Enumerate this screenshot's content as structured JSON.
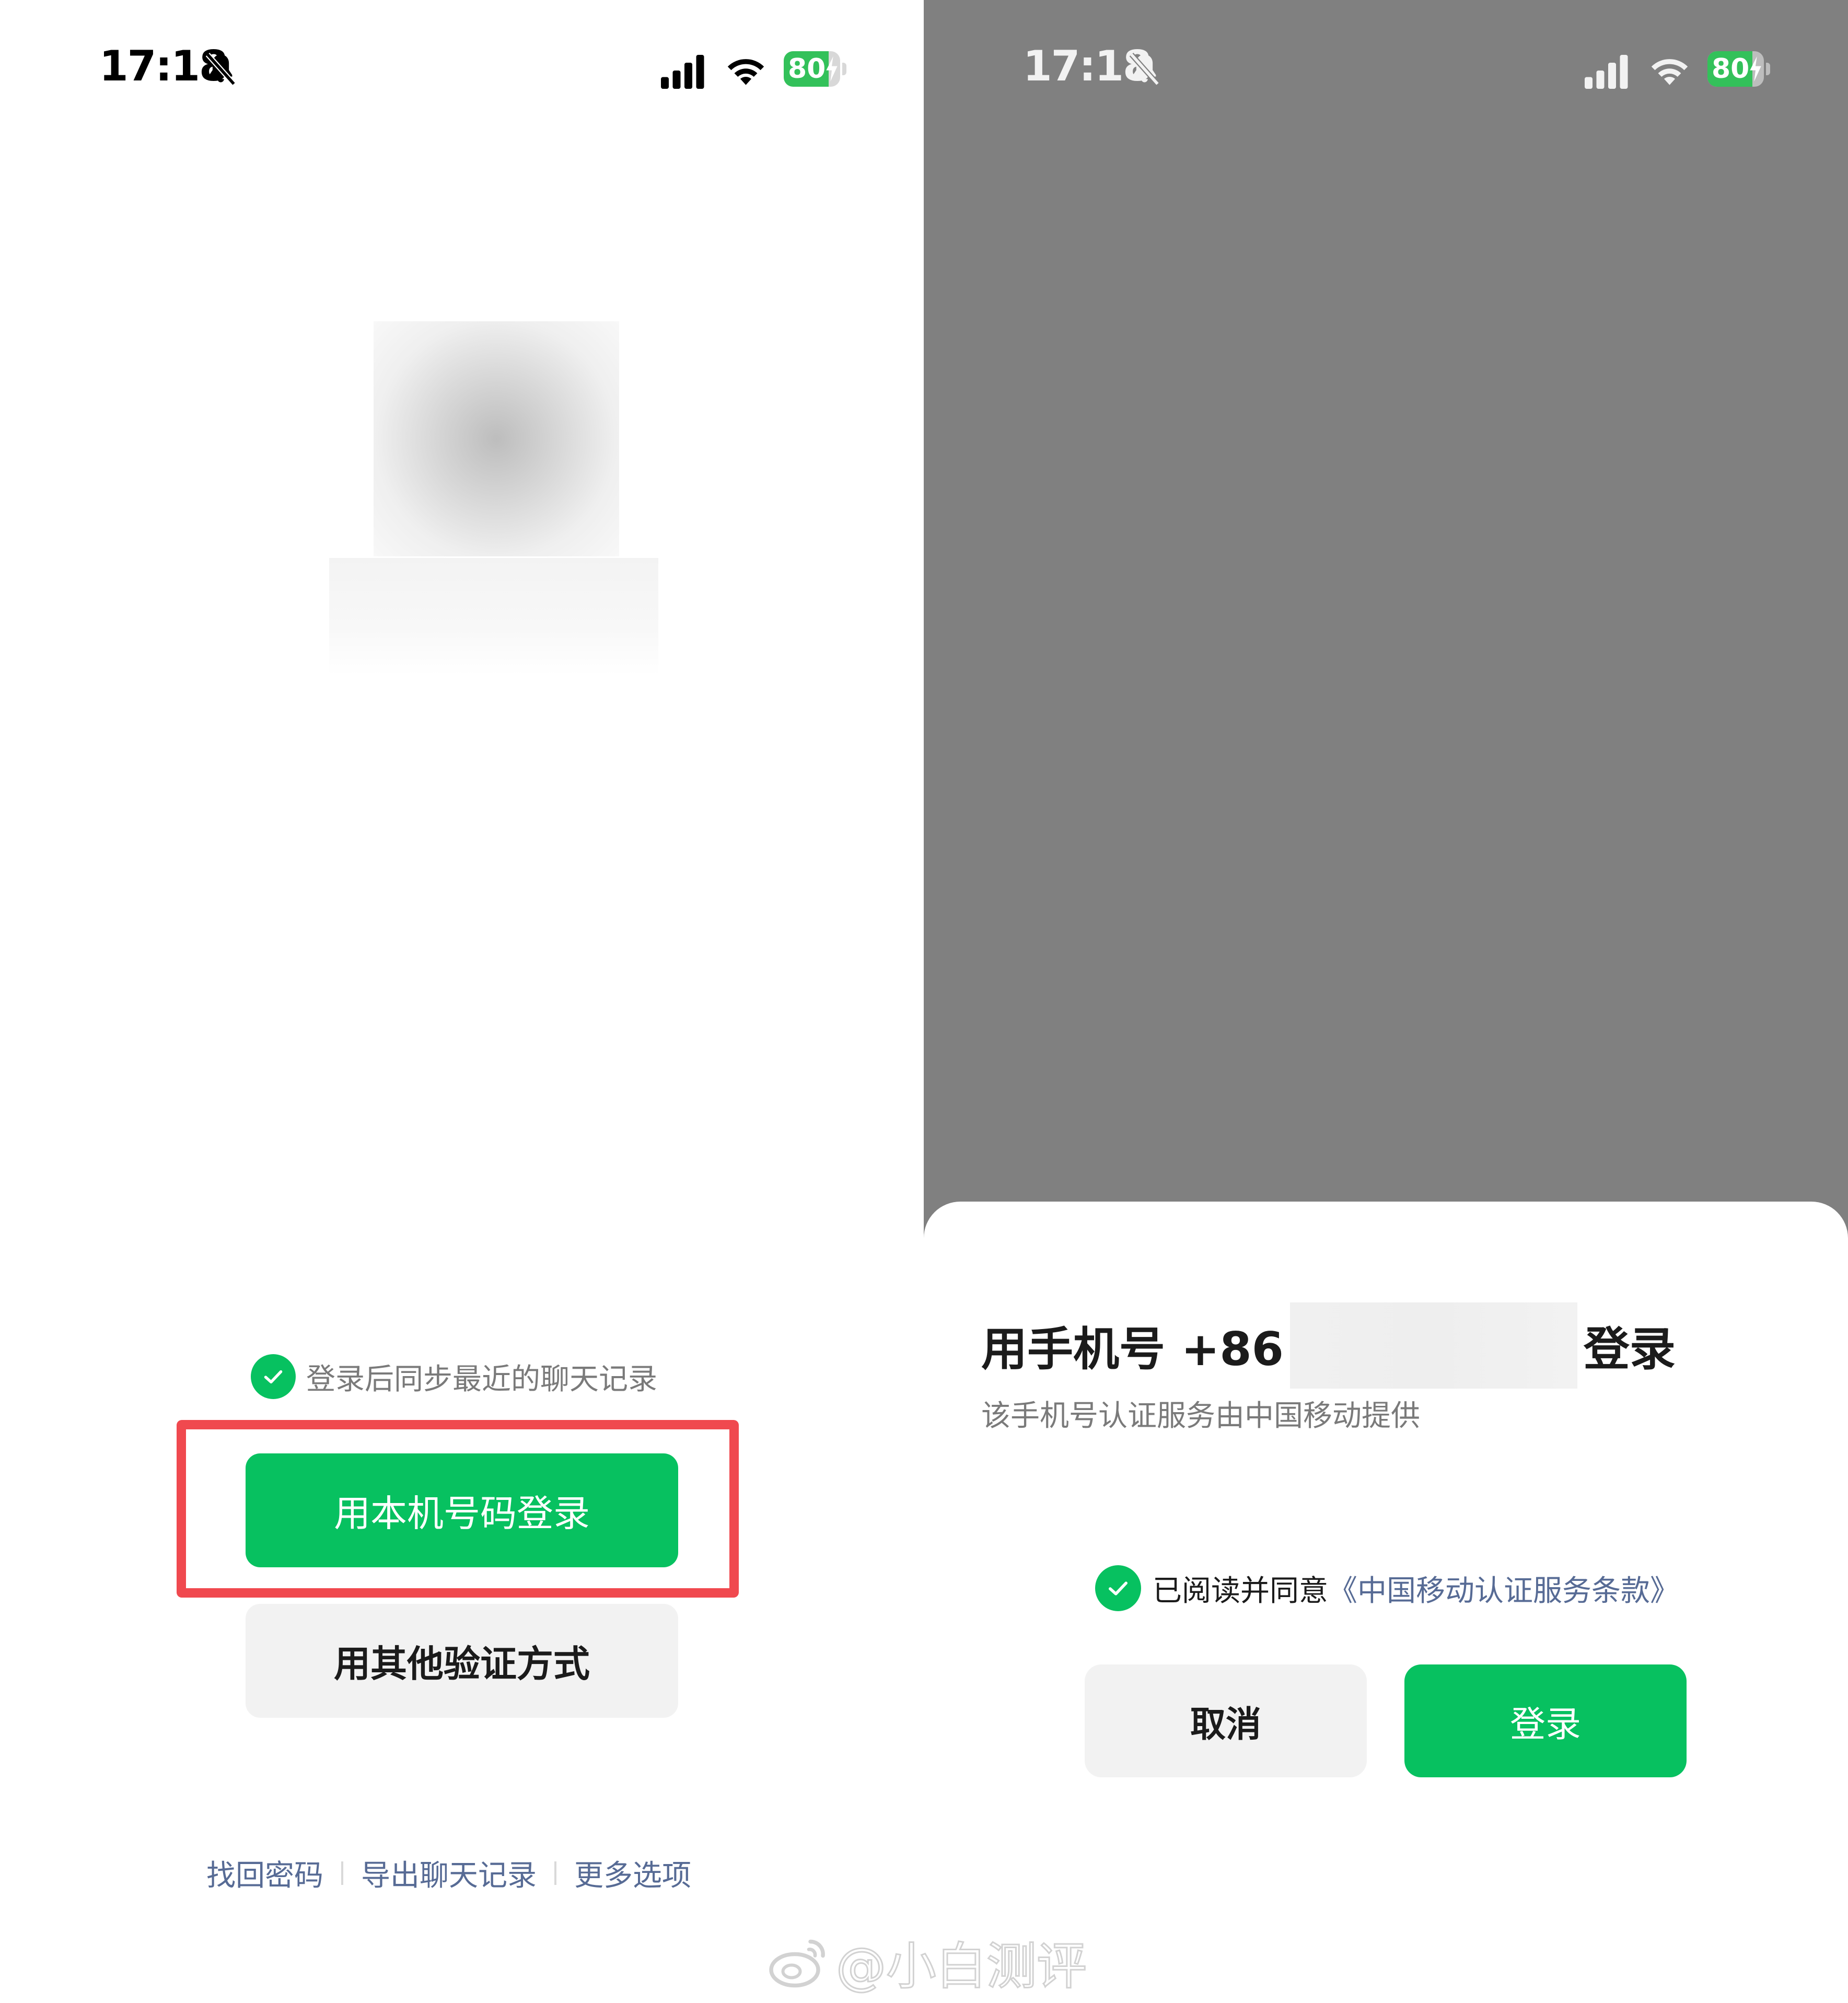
{
  "left": {
    "status_bar": {
      "time": "17:18",
      "battery": "80",
      "battery_fraction": 0.8
    },
    "sync_label": "登录后同步最近的聊天记录",
    "local_login_button": "用本机号码登录",
    "other_method_button": "用其他验证方式",
    "links": [
      "找回密码",
      "导出聊天记录",
      "更多选项"
    ]
  },
  "right": {
    "status_bar": {
      "time": "17:18",
      "battery": "80",
      "battery_fraction": 0.8
    },
    "sheet": {
      "title_prefix": "用手机号 +86",
      "title_suffix": "登录",
      "subtitle": "该手机号认证服务由中国移动提供",
      "agree_prefix": "已阅读并同意",
      "terms_link": "《中国移动认证服务条款》",
      "cancel_button": "取消",
      "login_button": "登录"
    }
  },
  "watermark": "@小白测评",
  "colors": {
    "accent_green": "#07c160",
    "link_blue": "#576b95",
    "highlight_red": "#f0494f",
    "overlay_gray": "#808080",
    "battery_green": "#33c15a"
  }
}
